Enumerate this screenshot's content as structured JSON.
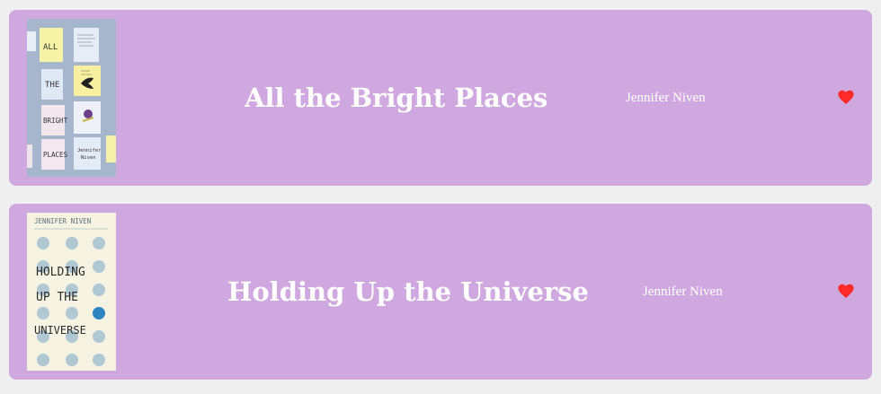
{
  "books": [
    {
      "title": "All the Bright Places",
      "author": "Jennifer Niven",
      "cover_words": [
        "ALL",
        "THE",
        "BRIGHT",
        "PLACES"
      ],
      "cover_author": [
        "Jennifer",
        "Niven"
      ],
      "favorite": true
    },
    {
      "title": "Holding Up the Universe",
      "author": "Jennifer Niven",
      "cover_author_line": "JENNIFER NIVEN",
      "cover_words": [
        "HOLDING",
        "UP THE",
        "UNIVERSE"
      ],
      "favorite": true
    }
  ],
  "colors": {
    "card_bg": "#cfa8df",
    "page_bg": "#efefef",
    "heart": "#ff2a2a"
  },
  "icons": {
    "favorite": "heart-icon"
  }
}
